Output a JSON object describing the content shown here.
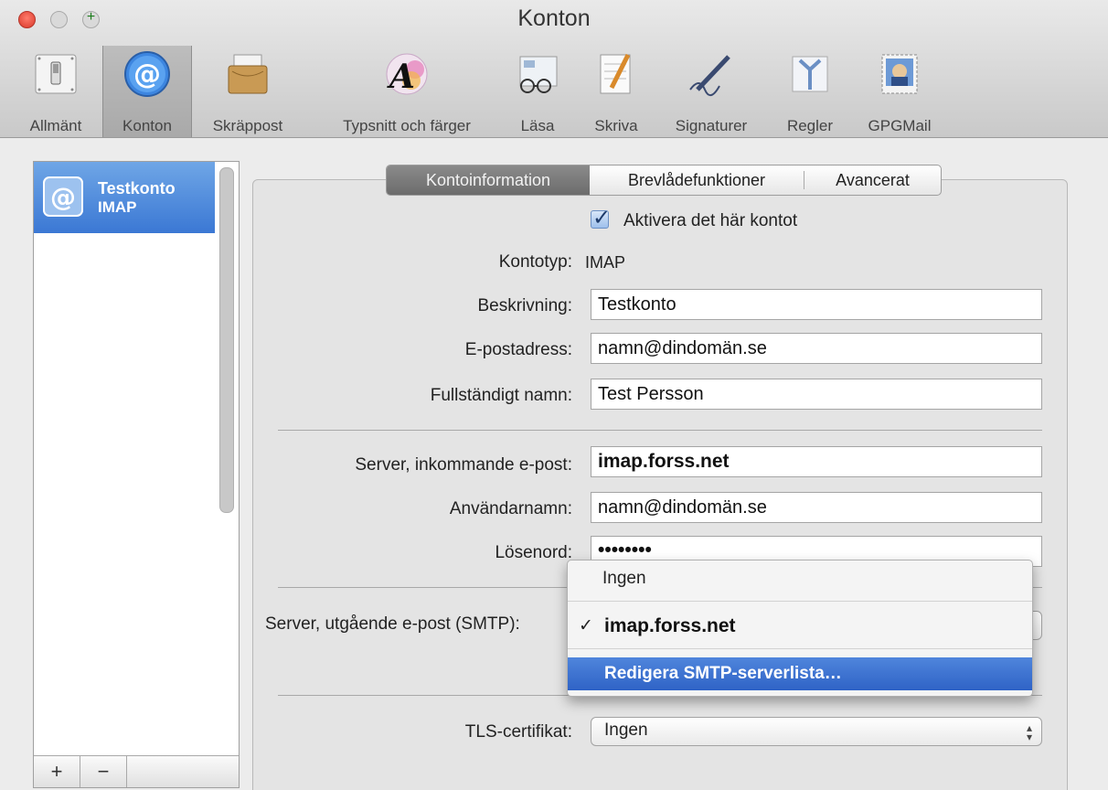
{
  "window": {
    "title": "Konton"
  },
  "toolbar": {
    "items": [
      {
        "label": "Allmänt",
        "icon": "switch-icon"
      },
      {
        "label": "Konton",
        "icon": "at-sign-icon"
      },
      {
        "label": "Skräppost",
        "icon": "junk-mail-icon"
      },
      {
        "label": "Typsnitt och färger",
        "icon": "font-color-icon"
      },
      {
        "label": "Läsa",
        "icon": "glasses-icon"
      },
      {
        "label": "Skriva",
        "icon": "pen-paper-icon"
      },
      {
        "label": "Signaturer",
        "icon": "signature-pen-icon"
      },
      {
        "label": "Regler",
        "icon": "rules-arrows-icon"
      },
      {
        "label": "GPGMail",
        "icon": "gpgmail-stamp-icon"
      }
    ]
  },
  "sidebar": {
    "accounts": [
      {
        "name": "Testkonto",
        "type": "IMAP"
      }
    ],
    "add_label": "+",
    "remove_label": "−"
  },
  "tabs": [
    {
      "label": "Kontoinformation",
      "active": true
    },
    {
      "label": "Brevlådefunktioner",
      "active": false
    },
    {
      "label": "Avancerat",
      "active": false
    }
  ],
  "form": {
    "enable_account": {
      "label": "Aktivera det här kontot",
      "checked": true
    },
    "account_type": {
      "label": "Kontotyp:",
      "value": "IMAP"
    },
    "description": {
      "label": "Beskrivning:",
      "value": "Testkonto"
    },
    "email": {
      "label": "E-postadress:",
      "value": "namn@dindomän.se"
    },
    "full_name": {
      "label": "Fullständigt namn:",
      "value": "Test Persson"
    },
    "incoming_server": {
      "label": "Server, inkommande e-post:",
      "value": "imap.forss.net"
    },
    "username": {
      "label": "Användarnamn:",
      "value": "namn@dindomän.se"
    },
    "password": {
      "label": "Lösenord:",
      "value": "••••••••"
    },
    "outgoing_server": {
      "label": "Server, utgående e-post (SMTP):"
    },
    "tls_certificate": {
      "label": "TLS-certifikat:",
      "value": "Ingen"
    }
  },
  "smtp_menu": {
    "items": [
      {
        "label": "Ingen"
      },
      {
        "label": "imap.forss.net",
        "checkmark": "✓"
      },
      {
        "label": "Redigera SMTP-serverlista…"
      }
    ]
  },
  "colors": {
    "accent": "#3b78d4",
    "selection_gradient_top": "#6fa6e6",
    "active_tab": "#7a7a7a",
    "close_button": "#e0483a"
  }
}
